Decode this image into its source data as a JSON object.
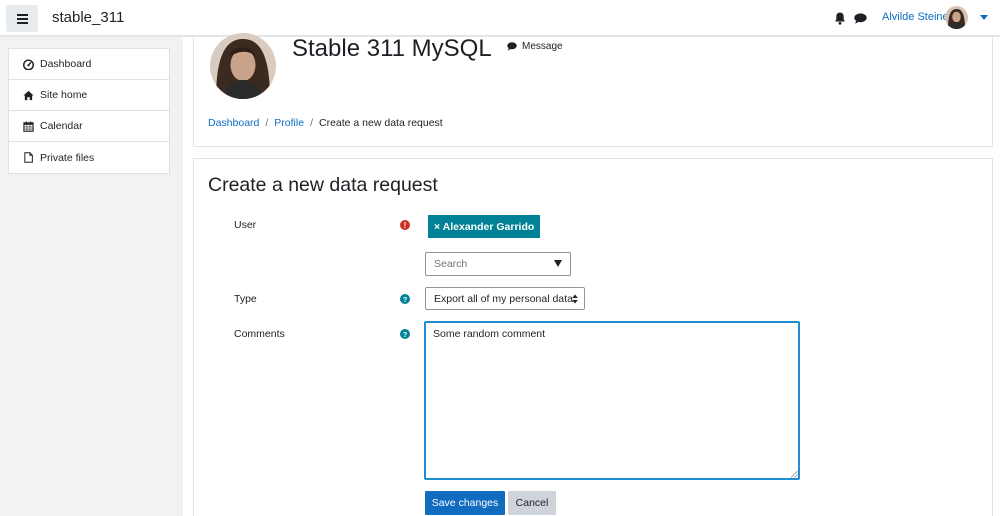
{
  "navbar": {
    "site_name": "stable_311",
    "user_name": "Alvilde Steine",
    "menu_icon": "hamburger-icon",
    "notifications_icon": "bell-icon",
    "messages_icon": "chat-icon"
  },
  "drawer": {
    "items": [
      {
        "label": "Dashboard",
        "icon": "dashboard-icon"
      },
      {
        "label": "Site home",
        "icon": "home-icon"
      },
      {
        "label": "Calendar",
        "icon": "calendar-icon"
      },
      {
        "label": "Private files",
        "icon": "file-icon"
      }
    ]
  },
  "header": {
    "title": "Stable 311 MySQL",
    "message_label": "Message",
    "breadcrumb": [
      "Dashboard",
      "Profile",
      "Create a new data request"
    ]
  },
  "form": {
    "title": "Create a new data request",
    "user_label": "User",
    "selected_user": "× Alexander Garrido",
    "search_placeholder": "Search",
    "type_label": "Type",
    "type_value": "Export all of my personal data",
    "comments_label": "Comments",
    "comments_value": "Some random comment",
    "save_label": "Save changes",
    "cancel_label": "Cancel"
  },
  "colors": {
    "primary": "#0f6cbf",
    "tag": "#008196",
    "required": "#ca3120",
    "focus": "#1f8ed0"
  }
}
